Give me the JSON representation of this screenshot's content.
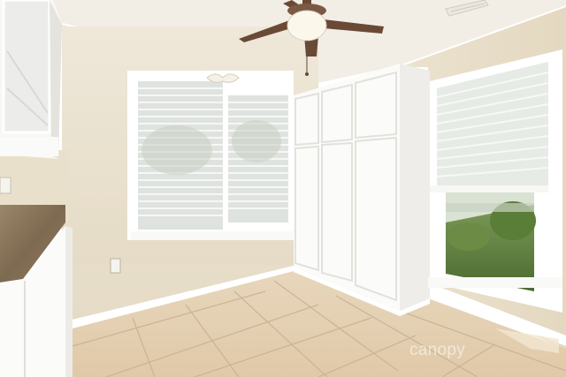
{
  "photo": {
    "subject": "empty-kitchen-dining-nook",
    "watermark_text": "canopy"
  },
  "palette": {
    "wall": "#ece4d4",
    "wall_shadow": "#e2d8c4",
    "ceiling": "#f3efe6",
    "trim": "#ffffff",
    "floor_tile": "#e6d3b8",
    "grout": "#cdb79a",
    "cabinet": "#fbfbf9",
    "countertop": "#8e7a5c",
    "fan_blade": "#6a4a36",
    "foliage": "#5d7f3c"
  },
  "icons": {
    "ceiling_fan": "ceiling-fan-icon",
    "outlet": "outlet-icon",
    "switch": "light-switch-icon",
    "vent": "air-vent-icon"
  }
}
